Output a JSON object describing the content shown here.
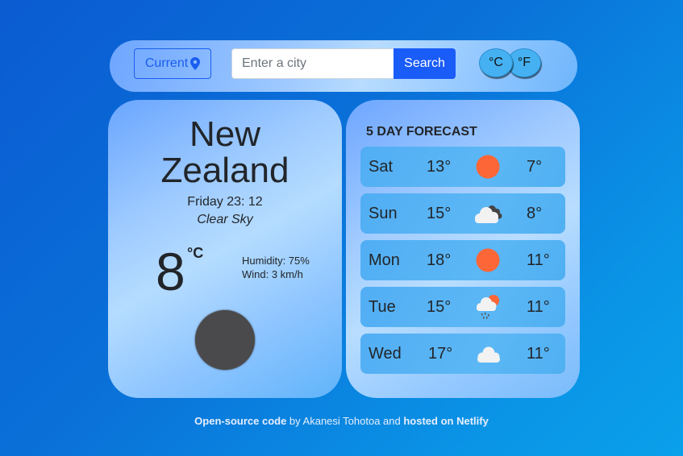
{
  "search": {
    "current_label": "Current",
    "placeholder": "Enter a city",
    "value": "",
    "search_label": "Search",
    "unit_c": "°C",
    "unit_f": "°F"
  },
  "current": {
    "city_line1": "New",
    "city_line2": "Zealand",
    "datetime": "Friday 23: 12",
    "description": "Clear Sky",
    "temperature": "8",
    "unit": "°C",
    "humidity": "Humidity: 75%",
    "wind": "Wind: 3 km/h",
    "icon": "dark-circle-icon"
  },
  "forecast": {
    "title": "5 DAY FORECAST",
    "days": [
      {
        "day": "Sat",
        "max": "13°",
        "min": "7°",
        "icon": "sun-icon"
      },
      {
        "day": "Sun",
        "max": "15°",
        "min": "8°",
        "icon": "cloud-dark-icon"
      },
      {
        "day": "Mon",
        "max": "18°",
        "min": "11°",
        "icon": "sun-icon"
      },
      {
        "day": "Tue",
        "max": "15°",
        "min": "11°",
        "icon": "rain-sun-icon"
      },
      {
        "day": "Wed",
        "max": "17°",
        "min": "11°",
        "icon": "cloud-icon"
      }
    ]
  },
  "footer": {
    "link1": "Open-source code",
    "text1": " by Akanesi Tohotoa and ",
    "link2": "hosted on Netlify"
  },
  "colors": {
    "accent": "#1a5cf8",
    "sun": "#fd6636"
  }
}
